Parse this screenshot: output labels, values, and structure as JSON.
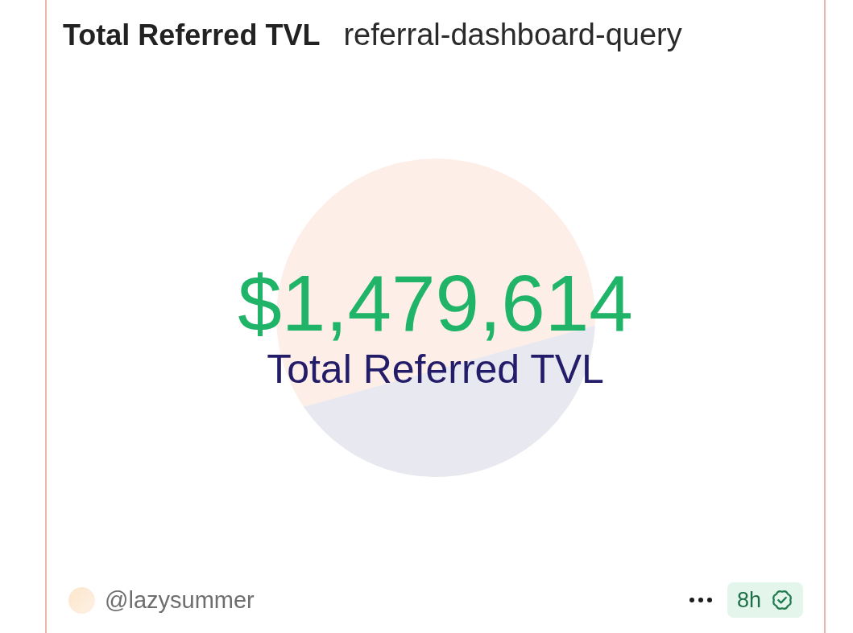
{
  "card": {
    "title": "Total Referred TVL",
    "query_name": "referral-dashboard-query",
    "counter": {
      "value": "$1,479,614",
      "label": "Total Referred TVL"
    },
    "footer": {
      "author": "@lazysummer",
      "age": "8h",
      "verified": true
    }
  }
}
